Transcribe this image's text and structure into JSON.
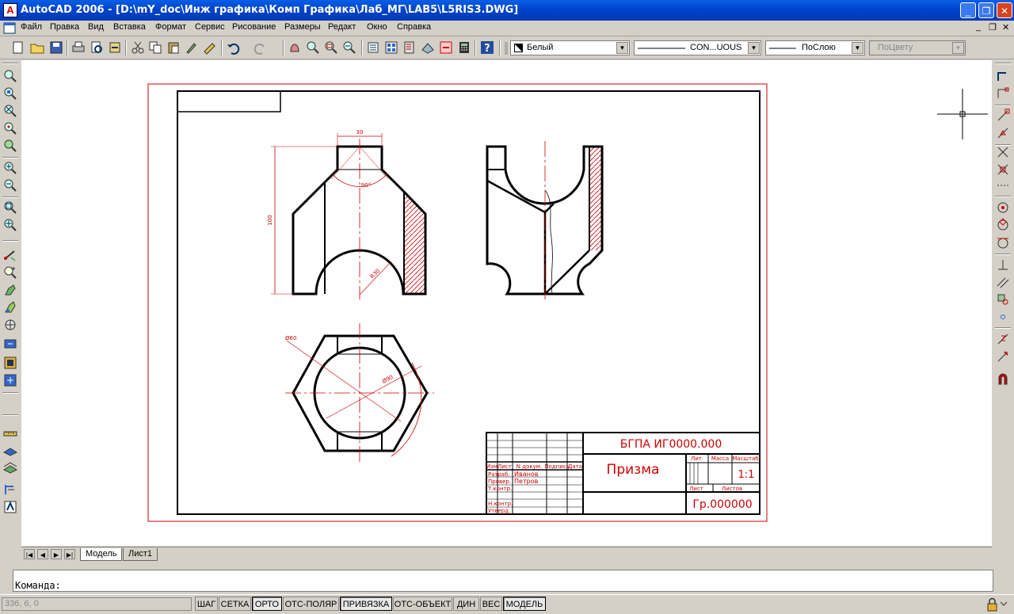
{
  "window": {
    "title": "AutoCAD 2006 - [D:\\mY_doc\\Инж графика\\Комп Графика\\Лаб_МГ\\LAB5\\L5RIS3.DWG]",
    "buttons": {
      "minimize": "_",
      "maximize": "❐",
      "close": "✕"
    }
  },
  "menu": {
    "items": [
      "Файл",
      "Правка",
      "Вид",
      "Вставка",
      "Формат",
      "Сервис",
      "Рисование",
      "Размеры",
      "Редакт",
      "Окно",
      "Справка"
    ],
    "mdi_buttons": [
      "_",
      "❐",
      "✕"
    ]
  },
  "properties": {
    "color": "Белый",
    "linetype": "CON...UOUS",
    "lineweight": "ПоСлою",
    "plotstyle": "ПоЦвету"
  },
  "model_tabs": {
    "nav": [
      "|◀",
      "◀",
      "▶",
      "▶|"
    ],
    "tabs": [
      "Модель",
      "Лист1"
    ]
  },
  "command": {
    "prompt": "Команда:"
  },
  "status": {
    "coords": "336, 6, 0",
    "buttons": [
      {
        "label": "ШАГ",
        "on": false
      },
      {
        "label": "СЕТКА",
        "on": false
      },
      {
        "label": "ОРТО",
        "on": true
      },
      {
        "label": "ОТС-ПОЛЯР",
        "on": false
      },
      {
        "label": "ПРИВЯЗКА",
        "on": true
      },
      {
        "label": "ОТС-ОБЪЕКТ",
        "on": false
      },
      {
        "label": "ДИН",
        "on": false
      },
      {
        "label": "ВЕС",
        "on": false
      },
      {
        "label": "МОДЕЛЬ",
        "on": true
      }
    ]
  },
  "drawing": {
    "dim_width": "30",
    "dim_height": "100",
    "dim_angle": "90°",
    "dim_radius": "R30",
    "dim_dia_inner": "Ø60",
    "dim_dia_outer": "Ø90",
    "stamp": {
      "code": "БГПА ИГ0000.000",
      "name": "Призма",
      "scale": "1:1",
      "group": "Гр.000000",
      "h_lit": "Лит.",
      "h_mass": "Масса",
      "h_scale": "Масштаб",
      "h_sheet": "Лист",
      "h_sheets": "Листов",
      "col_izm": "Изм",
      "col_list": "Лист",
      "col_doc": "N докум.",
      "col_sign": "Подпись",
      "col_date": "Дата",
      "r_razrab": "Разраб.",
      "r_prov": "Провер.",
      "r_tkontr": "Т.контр.",
      "r_nkontr": "Н.контр.",
      "r_utv": "Утверд.",
      "dev_name": "Иванов",
      "chk_name": "Петров"
    },
    "colors": {
      "line": "#000000",
      "accent": "#cc0000"
    }
  }
}
